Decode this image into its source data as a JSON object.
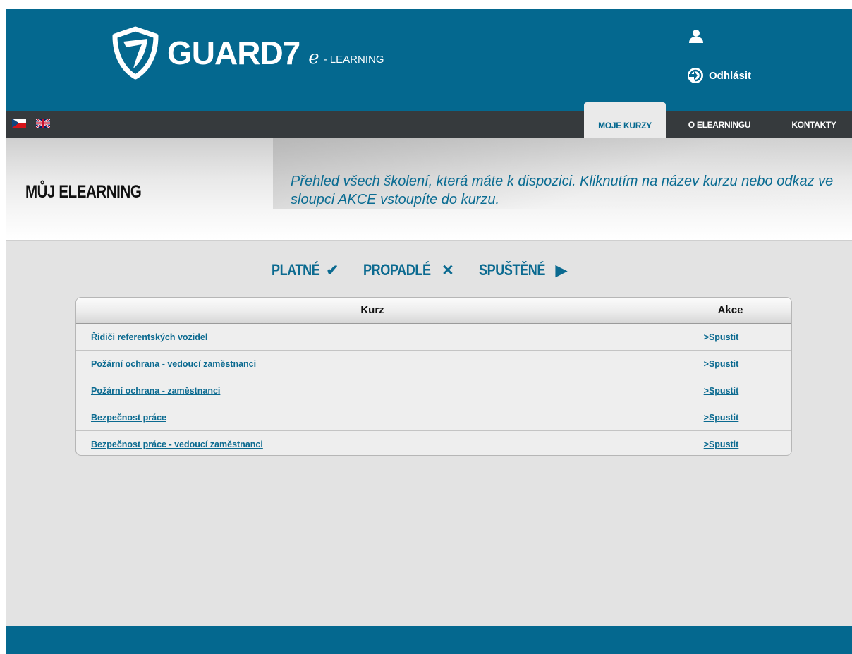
{
  "header": {
    "logo_text": "GUARD7",
    "logo_e": "e",
    "logo_suffix": "- LEARNING",
    "logout_label": "Odhlásit"
  },
  "nav": {
    "languages": [
      "cz-flag",
      "uk-flag"
    ],
    "items": [
      {
        "label": "MOJE KURZY",
        "active": true
      },
      {
        "label": "O ELEARNINGU",
        "active": false
      },
      {
        "label": "KONTAKTY",
        "active": false
      }
    ]
  },
  "banner": {
    "title": "MŮJ ELEARNING",
    "description": "Přehled všech školení, která máte k dispozici. Kliknutím na název kurzu nebo odkaz ve sloupci AKCE vstoupíte do kurzu."
  },
  "filters": [
    {
      "label": "PLATNÉ",
      "icon": "✔",
      "icon_name": "check-icon"
    },
    {
      "label": "PROPADLÉ",
      "icon": "✕",
      "icon_name": "cross-icon"
    },
    {
      "label": "SPUŠTĚNÉ",
      "icon": "▶",
      "icon_name": "play-icon"
    }
  ],
  "table": {
    "headers": {
      "kurz": "Kurz",
      "akce": "Akce"
    },
    "rows": [
      {
        "kurz": "Řidiči referentských vozidel",
        "akce": ">Spustit"
      },
      {
        "kurz": "Požární ochrana - vedoucí zaměstnanci",
        "akce": ">Spustit"
      },
      {
        "kurz": "Požární ochrana - zaměstnanci",
        "akce": ">Spustit"
      },
      {
        "kurz": "Bezpečnost práce",
        "akce": ">Spustit"
      },
      {
        "kurz": "Bezpečnost práce - vedoucí zaměstnanci",
        "akce": ">Spustit"
      }
    ]
  },
  "colors": {
    "brand_blue": "#04688f",
    "nav_dark": "#363a3d",
    "link_blue": "#0b6a90",
    "page_bg": "#e3e3e3"
  }
}
